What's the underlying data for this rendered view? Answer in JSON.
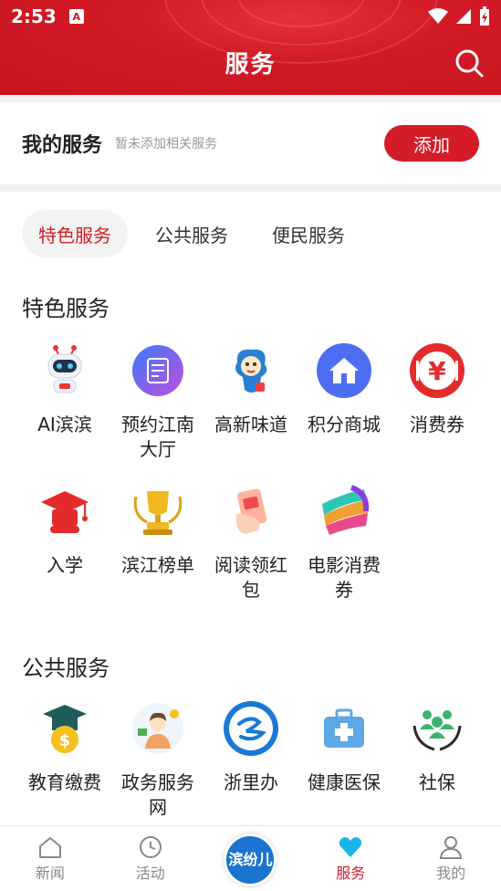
{
  "status_bar": {
    "time": "2:53"
  },
  "header": {
    "title": "服务"
  },
  "my_services": {
    "title": "我的服务",
    "hint": "暂未添加相关服务",
    "add_label": "添加"
  },
  "tabs": [
    {
      "label": "特色服务",
      "active": true
    },
    {
      "label": "公共服务",
      "active": false
    },
    {
      "label": "便民服务",
      "active": false
    }
  ],
  "featured": {
    "title": "特色服务",
    "items": [
      {
        "label": "AI滨滨",
        "icon": "robot-icon"
      },
      {
        "label": "预约江南大厅",
        "icon": "appointment-icon"
      },
      {
        "label": "高新味道",
        "icon": "mascot-icon"
      },
      {
        "label": "积分商城",
        "icon": "store-icon"
      },
      {
        "label": "消费券",
        "icon": "yuan-icon"
      },
      {
        "label": "入学",
        "icon": "graduation-cap-icon"
      },
      {
        "label": "滨江榜单",
        "icon": "trophy-icon"
      },
      {
        "label": "阅读领红包",
        "icon": "red-packet-icon"
      },
      {
        "label": "电影消费券",
        "icon": "film-icon"
      }
    ]
  },
  "public": {
    "title": "公共服务",
    "items": [
      {
        "label": "教育缴费",
        "icon": "tuition-icon"
      },
      {
        "label": "政务服务网",
        "icon": "gov-service-icon"
      },
      {
        "label": "浙里办",
        "icon": "zheliban-icon"
      },
      {
        "label": "健康医保",
        "icon": "medical-kit-icon"
      },
      {
        "label": "社保",
        "icon": "social-security-icon"
      }
    ]
  },
  "tabbar": [
    {
      "label": "新闻",
      "icon": "house-icon"
    },
    {
      "label": "活动",
      "icon": "clock-icon"
    },
    {
      "label": "滨纷儿",
      "icon": "center-logo-icon"
    },
    {
      "label": "服务",
      "icon": "heart-icon",
      "active": true
    },
    {
      "label": "我的",
      "icon": "person-icon"
    }
  ],
  "colors": {
    "brand_red": "#d41c27",
    "center_blue": "#1a74d0"
  }
}
